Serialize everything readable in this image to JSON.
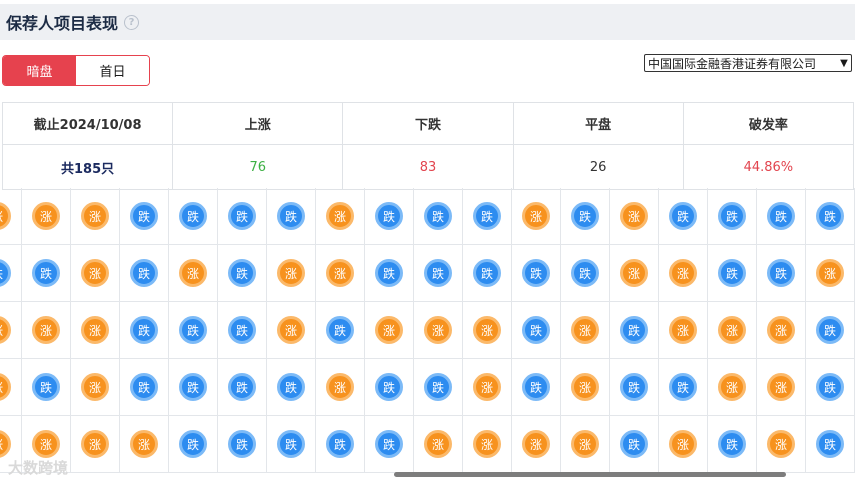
{
  "header": {
    "title": "保荐人项目表现",
    "help_icon": "question-circle-icon"
  },
  "toggle": {
    "options": [
      "暗盘",
      "首日"
    ],
    "selected": "暗盘"
  },
  "sponsor_select": {
    "value": "中国国际金融香港证券有限公司"
  },
  "stats": {
    "headers": [
      "截止2024/10/08",
      "上涨",
      "下跌",
      "平盘",
      "破发率"
    ],
    "values": {
      "total": "共185只",
      "up": "76",
      "down": "83",
      "flat": "26",
      "break_rate": "44.86%"
    },
    "colors": {
      "up": "#3cb043",
      "down": "#e2454f"
    }
  },
  "grid": {
    "labels": {
      "rise": "涨",
      "fall": "跌"
    },
    "colors": {
      "rise": "#f7921e",
      "fall": "#2d8cf0"
    },
    "rows": [
      [
        "rise",
        "rise",
        "rise",
        "fall",
        "fall",
        "fall",
        "fall",
        "rise",
        "fall",
        "fall",
        "fall",
        "rise",
        "fall",
        "rise",
        "fall",
        "fall",
        "fall",
        "fall"
      ],
      [
        "fall",
        "fall",
        "rise",
        "fall",
        "rise",
        "fall",
        "rise",
        "rise",
        "fall",
        "fall",
        "fall",
        "fall",
        "fall",
        "rise",
        "rise",
        "fall",
        "fall",
        "rise"
      ],
      [
        "rise",
        "rise",
        "rise",
        "fall",
        "fall",
        "fall",
        "rise",
        "fall",
        "rise",
        "rise",
        "rise",
        "fall",
        "rise",
        "fall",
        "rise",
        "rise",
        "rise",
        "fall"
      ],
      [
        "rise",
        "fall",
        "rise",
        "fall",
        "fall",
        "fall",
        "fall",
        "rise",
        "fall",
        "fall",
        "rise",
        "fall",
        "rise",
        "fall",
        "fall",
        "rise",
        "rise",
        "fall"
      ],
      [
        "rise",
        "rise",
        "rise",
        "rise",
        "fall",
        "fall",
        "fall",
        "fall",
        "fall",
        "rise",
        "rise",
        "rise",
        "rise",
        "fall",
        "rise",
        "fall",
        "rise",
        "fall"
      ]
    ]
  },
  "watermark": "大数跨境"
}
